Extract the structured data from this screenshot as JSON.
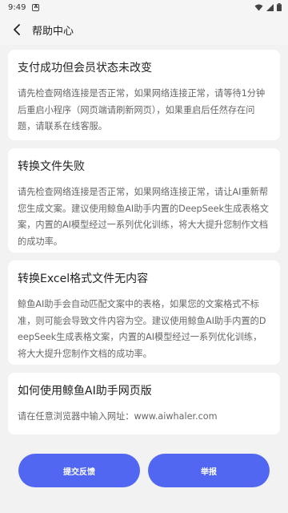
{
  "status_bar": {
    "time": "9:49",
    "notification_glyph": "A",
    "icons": [
      "wifi-icon",
      "signal-icon",
      "battery-icon"
    ]
  },
  "header": {
    "title": "帮助中心",
    "back_icon": "chevron-left-icon"
  },
  "faq": [
    {
      "title": "支付成功但会员状态未改变",
      "body": "请先检查网络连接是否正常，如果网络连接正常，请等待1分钟后重启小程序（网页端请刷新网页），如果重启后任然存在问题，请联系在线客服。"
    },
    {
      "title": "转换文件失败",
      "body": "请先检查网络连接是否正常，如果网络连接正常，请让AI重新帮您生成文案。建议使用鲸鱼AI助手内置的DeepSeek生成表格文案，内置的AI模型经过一系列优化训练，将大大提升您制作文档的成功率。"
    },
    {
      "title": "转换Excel格式文件无内容",
      "body": "鲸鱼AI助手会自动匹配文案中的表格，如果您的文案格式不标准，则可能会导致文件内容为空。建议使用鲸鱼AI助手内置的DeepSeek生成表格文案，内置的AI模型经过一系列优化训练，将大大提升您制作文档的成功率。"
    },
    {
      "title": "如何使用鲸鱼AI助手网页版",
      "body": "请在任意浏览器中输入网址：www.aiwhaler.com"
    }
  ],
  "actions": {
    "feedback_label": "提交反馈",
    "report_label": "举报"
  },
  "colors": {
    "accent": "#5167f2",
    "background": "#f2f2f2",
    "card": "#ffffff"
  }
}
